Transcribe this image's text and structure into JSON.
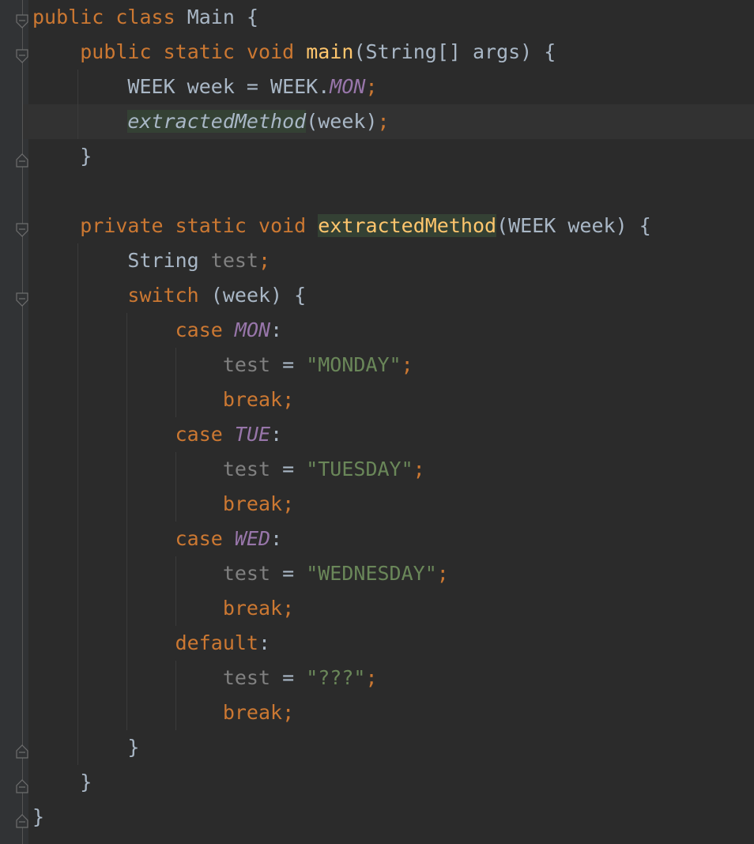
{
  "lines": [
    {
      "tokens": [
        {
          "t": "public",
          "c": "kw"
        },
        {
          "t": " ",
          "c": "pl"
        },
        {
          "t": "class",
          "c": "kw"
        },
        {
          "t": " Main {",
          "c": "pl"
        }
      ]
    },
    {
      "tokens": [
        {
          "t": "    ",
          "c": "pl"
        },
        {
          "t": "public",
          "c": "kw"
        },
        {
          "t": " ",
          "c": "pl"
        },
        {
          "t": "static",
          "c": "kw"
        },
        {
          "t": " ",
          "c": "pl"
        },
        {
          "t": "void",
          "c": "kw"
        },
        {
          "t": " ",
          "c": "pl"
        },
        {
          "t": "main",
          "c": "fn"
        },
        {
          "t": "(String[] args) {",
          "c": "pl"
        }
      ]
    },
    {
      "tokens": [
        {
          "t": "        WEEK week = WEEK.",
          "c": "pl"
        },
        {
          "t": "MON",
          "c": "cst"
        },
        {
          "t": ";",
          "c": "kw"
        }
      ]
    },
    {
      "tokens": [
        {
          "t": "        ",
          "c": "pl"
        },
        {
          "t": "extractedMethod",
          "c": "pl it hl"
        },
        {
          "t": "(week)",
          "c": "pl"
        },
        {
          "t": ";",
          "c": "kw"
        }
      ]
    },
    {
      "tokens": [
        {
          "t": "    }",
          "c": "pl"
        }
      ]
    },
    {
      "tokens": [
        {
          "t": "",
          "c": "pl"
        }
      ]
    },
    {
      "tokens": [
        {
          "t": "    ",
          "c": "pl"
        },
        {
          "t": "private",
          "c": "kw"
        },
        {
          "t": " ",
          "c": "pl"
        },
        {
          "t": "static",
          "c": "kw"
        },
        {
          "t": " ",
          "c": "pl"
        },
        {
          "t": "void",
          "c": "kw"
        },
        {
          "t": " ",
          "c": "pl"
        },
        {
          "t": "extractedMethod",
          "c": "fn hl"
        },
        {
          "t": "(WEEK week) {",
          "c": "pl"
        }
      ]
    },
    {
      "tokens": [
        {
          "t": "        String ",
          "c": "pl"
        },
        {
          "t": "test",
          "c": "unused"
        },
        {
          "t": ";",
          "c": "kw"
        }
      ]
    },
    {
      "tokens": [
        {
          "t": "        ",
          "c": "pl"
        },
        {
          "t": "switch",
          "c": "kw"
        },
        {
          "t": " (week) {",
          "c": "pl"
        }
      ]
    },
    {
      "tokens": [
        {
          "t": "            ",
          "c": "pl"
        },
        {
          "t": "case",
          "c": "kw"
        },
        {
          "t": " ",
          "c": "pl"
        },
        {
          "t": "MON",
          "c": "cst"
        },
        {
          "t": ":",
          "c": "pl"
        }
      ]
    },
    {
      "tokens": [
        {
          "t": "                ",
          "c": "pl"
        },
        {
          "t": "test",
          "c": "unused"
        },
        {
          "t": " = ",
          "c": "pl"
        },
        {
          "t": "\"MONDAY\"",
          "c": "str"
        },
        {
          "t": ";",
          "c": "kw"
        }
      ]
    },
    {
      "tokens": [
        {
          "t": "                ",
          "c": "pl"
        },
        {
          "t": "break;",
          "c": "kw"
        }
      ]
    },
    {
      "tokens": [
        {
          "t": "            ",
          "c": "pl"
        },
        {
          "t": "case",
          "c": "kw"
        },
        {
          "t": " ",
          "c": "pl"
        },
        {
          "t": "TUE",
          "c": "cst"
        },
        {
          "t": ":",
          "c": "pl"
        }
      ]
    },
    {
      "tokens": [
        {
          "t": "                ",
          "c": "pl"
        },
        {
          "t": "test",
          "c": "unused"
        },
        {
          "t": " = ",
          "c": "pl"
        },
        {
          "t": "\"TUESDAY\"",
          "c": "str"
        },
        {
          "t": ";",
          "c": "kw"
        }
      ]
    },
    {
      "tokens": [
        {
          "t": "                ",
          "c": "pl"
        },
        {
          "t": "break;",
          "c": "kw"
        }
      ]
    },
    {
      "tokens": [
        {
          "t": "            ",
          "c": "pl"
        },
        {
          "t": "case",
          "c": "kw"
        },
        {
          "t": " ",
          "c": "pl"
        },
        {
          "t": "WED",
          "c": "cst"
        },
        {
          "t": ":",
          "c": "pl"
        }
      ]
    },
    {
      "tokens": [
        {
          "t": "                ",
          "c": "pl"
        },
        {
          "t": "test",
          "c": "unused"
        },
        {
          "t": " = ",
          "c": "pl"
        },
        {
          "t": "\"WEDNESDAY\"",
          "c": "str"
        },
        {
          "t": ";",
          "c": "kw"
        }
      ]
    },
    {
      "tokens": [
        {
          "t": "                ",
          "c": "pl"
        },
        {
          "t": "break;",
          "c": "kw"
        }
      ]
    },
    {
      "tokens": [
        {
          "t": "            ",
          "c": "pl"
        },
        {
          "t": "default",
          "c": "kw"
        },
        {
          "t": ":",
          "c": "pl"
        }
      ]
    },
    {
      "tokens": [
        {
          "t": "                ",
          "c": "pl"
        },
        {
          "t": "test",
          "c": "unused"
        },
        {
          "t": " = ",
          "c": "pl"
        },
        {
          "t": "\"???\"",
          "c": "str"
        },
        {
          "t": ";",
          "c": "kw"
        }
      ]
    },
    {
      "tokens": [
        {
          "t": "                ",
          "c": "pl"
        },
        {
          "t": "break;",
          "c": "kw"
        }
      ]
    },
    {
      "tokens": [
        {
          "t": "        }",
          "c": "pl"
        }
      ]
    },
    {
      "tokens": [
        {
          "t": "    }",
          "c": "pl"
        }
      ]
    },
    {
      "tokens": [
        {
          "t": "}",
          "c": "pl"
        }
      ]
    }
  ],
  "fold_markers": [
    {
      "line": 0,
      "type": "open"
    },
    {
      "line": 1,
      "type": "open"
    },
    {
      "line": 4,
      "type": "close"
    },
    {
      "line": 6,
      "type": "open"
    },
    {
      "line": 8,
      "type": "open"
    },
    {
      "line": 21,
      "type": "close"
    },
    {
      "line": 22,
      "type": "close"
    },
    {
      "line": 23,
      "type": "close"
    }
  ],
  "caret_line": 3,
  "colors": {
    "background": "#2b2b2b",
    "keyword": "#cc7832",
    "plain": "#a9b7c6",
    "method_declaration": "#ffc66d",
    "constant": "#9876aa",
    "string": "#6a8759",
    "unused": "#808080",
    "highlight": "#344134",
    "caret_row": "#323232"
  },
  "icons": {
    "fold_open": "fold-open-icon",
    "fold_close": "fold-close-icon"
  }
}
